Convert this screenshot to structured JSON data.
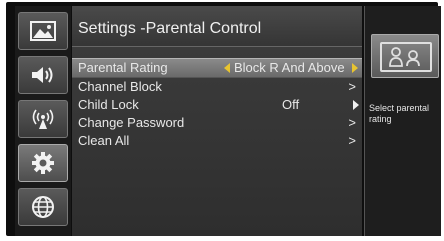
{
  "header": {
    "title": "Settings -Parental Control"
  },
  "rail": {
    "items": [
      {
        "icon": "picture-icon"
      },
      {
        "icon": "speaker-icon"
      },
      {
        "icon": "broadcast-icon"
      },
      {
        "icon": "gear-icon",
        "active": true
      },
      {
        "icon": "globe-icon"
      }
    ]
  },
  "menu": {
    "items": [
      {
        "label": "Parental Rating",
        "value": "Block R And Above",
        "selected": true
      },
      {
        "label": "Channel Block",
        "arrow": ">"
      },
      {
        "label": "Child Lock",
        "value": "Off"
      },
      {
        "label": "Change Password",
        "arrow": ">"
      },
      {
        "label": "Clean All",
        "arrow": ">"
      }
    ]
  },
  "info": {
    "icon": "parental-lock-icon",
    "text": "Select parental rating"
  },
  "colors": {
    "accent": "#e7c430",
    "background": "#0e0e0e"
  }
}
